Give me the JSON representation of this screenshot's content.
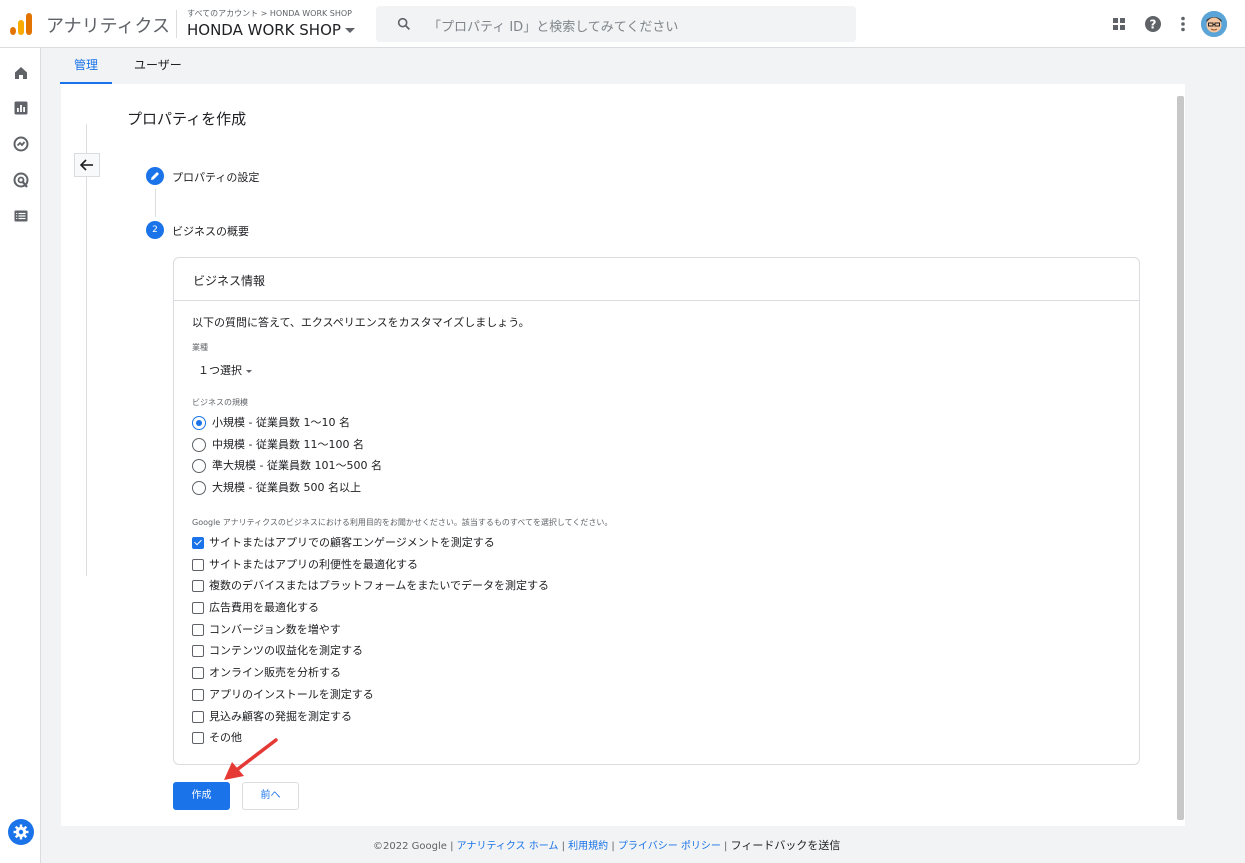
{
  "header": {
    "app_name": "アナリティクス",
    "breadcrumb": "すべてのアカウント > HONDA WORK SHOP",
    "account_name": "HONDA WORK SHOP",
    "search_placeholder": "「プロパティ ID」と検索してみてください"
  },
  "tabs": {
    "admin": "管理",
    "users": "ユーザー"
  },
  "page": {
    "title": "プロパティを作成",
    "step1_label": "プロパティの設定",
    "step2_number": "2",
    "step2_label": "ビジネスの概要"
  },
  "card": {
    "title": "ビジネス情報",
    "intro": "以下の質問に答えて、エクスペリエンスをカスタマイズしましょう。",
    "industry_label": "業種",
    "industry_value": "１つ選択",
    "size_label": "ビジネスの規模",
    "size_options": [
      {
        "label": "小規模 - 従業員数 1～10 名",
        "selected": true
      },
      {
        "label": "中規模 - 従業員数 11～100 名",
        "selected": false
      },
      {
        "label": "準大規模 - 従業員数 101～500 名",
        "selected": false
      },
      {
        "label": "大規模 - 従業員数 500 名以上",
        "selected": false
      }
    ],
    "purpose_label": "Google アナリティクスのビジネスにおける利用目的をお聞かせください。該当するものすべてを選択してください。",
    "purpose_options": [
      {
        "label": "サイトまたはアプリでの顧客エンゲージメントを測定する",
        "checked": true
      },
      {
        "label": "サイトまたはアプリの利便性を最適化する",
        "checked": false
      },
      {
        "label": "複数のデバイスまたはプラットフォームをまたいでデータを測定する",
        "checked": false
      },
      {
        "label": "広告費用を最適化する",
        "checked": false
      },
      {
        "label": "コンバージョン数を増やす",
        "checked": false
      },
      {
        "label": "コンテンツの収益化を測定する",
        "checked": false
      },
      {
        "label": "オンライン販売を分析する",
        "checked": false
      },
      {
        "label": "アプリのインストールを測定する",
        "checked": false
      },
      {
        "label": "見込み顧客の発掘を測定する",
        "checked": false
      },
      {
        "label": "その他",
        "checked": false
      }
    ]
  },
  "buttons": {
    "create": "作成",
    "previous": "前へ"
  },
  "footer": {
    "copyright": "©2022 Google",
    "sep": " | ",
    "analytics_home": "アナリティクス ホーム",
    "terms": "利用規約",
    "privacy": "プライバシー ポリシー",
    "feedback": "フィードバックを送信"
  },
  "colors": {
    "accent": "#1a73e8",
    "logo_orange": "#e37400",
    "logo_yellow": "#f9ab00",
    "arrow_red": "#e53935"
  }
}
